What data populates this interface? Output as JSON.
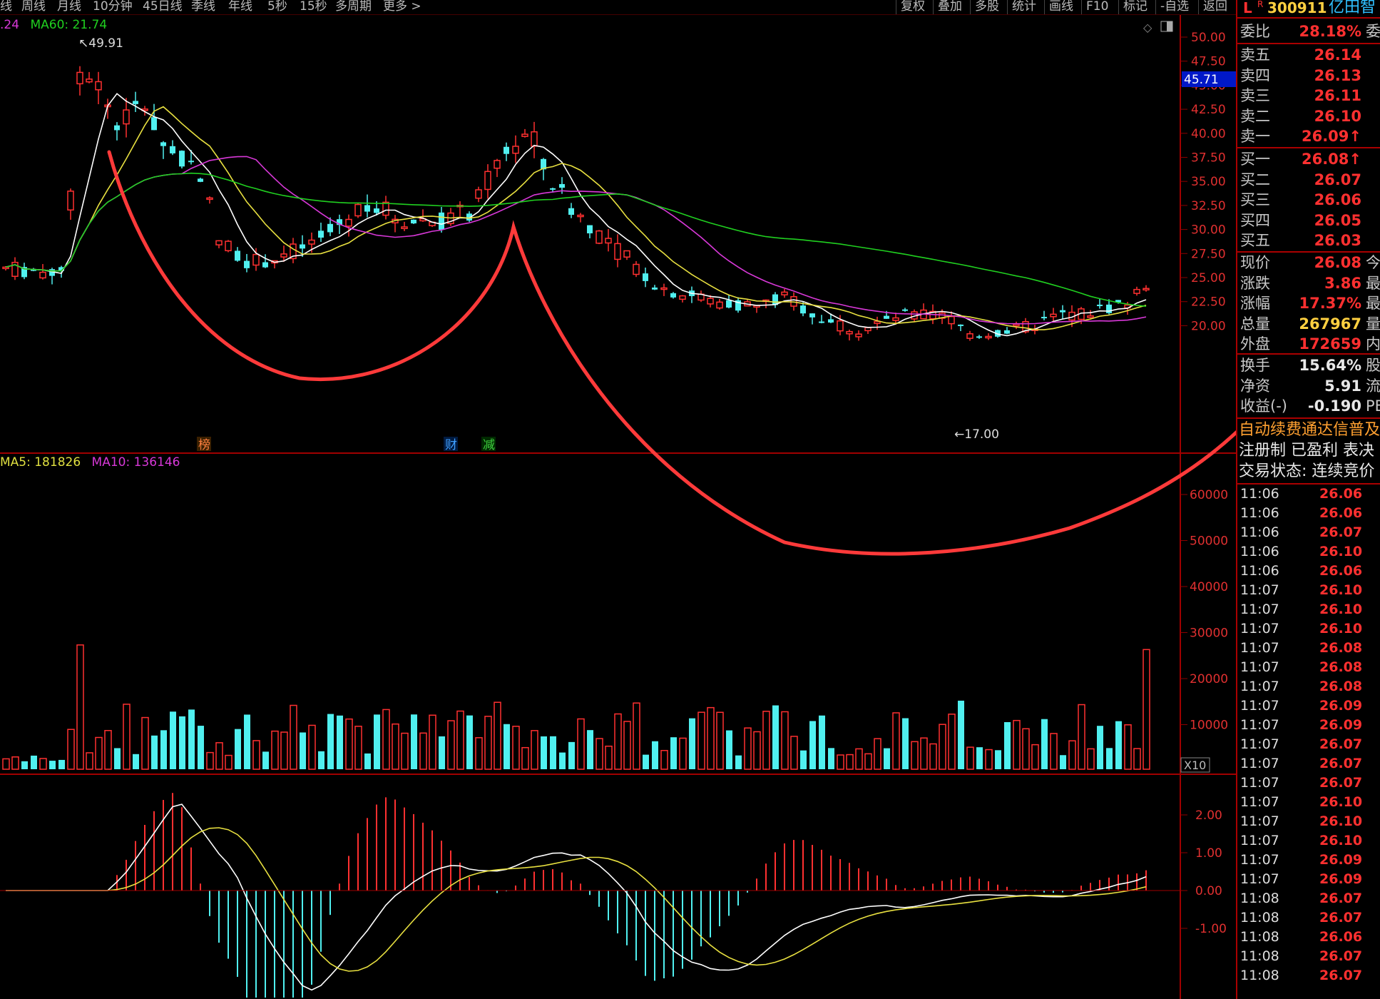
{
  "toolbar": {
    "left_items": [
      "线",
      "周线",
      "月线",
      "10分钟",
      "45日线",
      "季线",
      "年线",
      "5秒",
      "15秒",
      "多周期",
      "更多 >"
    ],
    "right_items": [
      "复权",
      "叠加",
      "多股",
      "统计",
      "画线",
      "F10",
      "标记",
      "-自选",
      "返回"
    ]
  },
  "main_chart": {
    "legend": [
      {
        "text": ".24",
        "color": "#d838d8"
      },
      {
        "text": "MA60: 21.74",
        "color": "#20d020"
      }
    ],
    "high_label": "49.91",
    "low_label": "17.00",
    "current_price_tag": "45.71",
    "y_ticks": [
      "50.00",
      "47.50",
      "45.00",
      "42.50",
      "40.00",
      "37.50",
      "35.00",
      "32.50",
      "30.00",
      "27.50",
      "25.00",
      "22.50",
      "20.00"
    ],
    "markers": [
      {
        "text": "榜",
        "color": "#ff8040"
      },
      {
        "text": "财",
        "color": "#40a0ff"
      },
      {
        "text": "减",
        "color": "#40d040"
      }
    ]
  },
  "volume_chart": {
    "legend": [
      {
        "text": "MA5: 181826",
        "color": "#e0e040"
      },
      {
        "text": "MA10: 136146",
        "color": "#d838d8"
      }
    ],
    "y_ticks": [
      "60000",
      "50000",
      "40000",
      "30000",
      "20000",
      "10000"
    ],
    "unit": "X10"
  },
  "macd_chart": {
    "y_ticks": [
      "2.00",
      "1.00",
      "0.00",
      "-1.00"
    ]
  },
  "quote": {
    "l": "L",
    "r": "R",
    "code": "300911",
    "name": "亿田智",
    "weibi_label": "委比",
    "weibi_value": "28.18%",
    "weibi_extra": "委",
    "asks": [
      {
        "label": "卖五",
        "price": "26.14"
      },
      {
        "label": "卖四",
        "price": "26.13"
      },
      {
        "label": "卖三",
        "price": "26.11"
      },
      {
        "label": "卖二",
        "price": "26.10"
      },
      {
        "label": "卖一",
        "price": "26.09↑"
      }
    ],
    "bids": [
      {
        "label": "买一",
        "price": "26.08↑"
      },
      {
        "label": "买二",
        "price": "26.07"
      },
      {
        "label": "买三",
        "price": "26.06"
      },
      {
        "label": "买四",
        "price": "26.05"
      },
      {
        "label": "买五",
        "price": "26.03"
      }
    ],
    "stats": [
      {
        "label": "现价",
        "value": "26.08",
        "extra": "今",
        "color": "#ff3030"
      },
      {
        "label": "涨跌",
        "value": "3.86",
        "extra": "最",
        "color": "#ff3030"
      },
      {
        "label": "涨幅",
        "value": "17.37%",
        "extra": "最",
        "color": "#ff3030"
      },
      {
        "label": "总量",
        "value": "267967",
        "extra": "量",
        "color": "#ffd040"
      },
      {
        "label": "外盘",
        "value": "172659",
        "extra": "内",
        "color": "#ff3030"
      }
    ],
    "stats2": [
      {
        "label": "换手",
        "value": "15.64%",
        "extra": "股",
        "color": "#e8e8e8"
      },
      {
        "label": "净资",
        "value": "5.91",
        "extra": "流",
        "color": "#e8e8e8"
      },
      {
        "label": "收益(-)",
        "value": "-0.190",
        "extra": "PE",
        "color": "#e8e8e8"
      }
    ],
    "notices": [
      {
        "text": "自动续费通达信普及",
        "color": "#ffa030"
      },
      {
        "text": "注册制 已盈利 表决",
        "color": "#e8e8e8"
      },
      {
        "text": "交易状态: 连续竞价",
        "color": "#e8e8e8"
      }
    ],
    "ticks": [
      {
        "time": "11:06",
        "price": "26.06"
      },
      {
        "time": "11:06",
        "price": "26.06"
      },
      {
        "time": "11:06",
        "price": "26.07"
      },
      {
        "time": "11:06",
        "price": "26.10"
      },
      {
        "time": "11:06",
        "price": "26.06"
      },
      {
        "time": "11:07",
        "price": "26.10"
      },
      {
        "time": "11:07",
        "price": "26.10"
      },
      {
        "time": "11:07",
        "price": "26.10"
      },
      {
        "time": "11:07",
        "price": "26.08"
      },
      {
        "time": "11:07",
        "price": "26.08"
      },
      {
        "time": "11:07",
        "price": "26.08"
      },
      {
        "time": "11:07",
        "price": "26.09"
      },
      {
        "time": "11:07",
        "price": "26.09"
      },
      {
        "time": "11:07",
        "price": "26.07"
      },
      {
        "time": "11:07",
        "price": "26.07"
      },
      {
        "time": "11:07",
        "price": "26.07"
      },
      {
        "time": "11:07",
        "price": "26.10"
      },
      {
        "time": "11:07",
        "price": "26.10"
      },
      {
        "time": "11:07",
        "price": "26.10"
      },
      {
        "time": "11:07",
        "price": "26.09"
      },
      {
        "time": "11:07",
        "price": "26.09"
      },
      {
        "time": "11:08",
        "price": "26.07"
      },
      {
        "time": "11:08",
        "price": "26.07"
      },
      {
        "time": "11:08",
        "price": "26.06"
      },
      {
        "time": "11:08",
        "price": "26.07"
      },
      {
        "time": "11:08",
        "price": "26.07"
      }
    ]
  },
  "colors": {
    "up": "#ff3030",
    "down": "#50f0f0",
    "ma5": "#ffffff",
    "ma10": "#e8e040",
    "ma20": "#d838d8",
    "ma60": "#20d020",
    "grid": "#8b0000",
    "annotation": "#ff3a3a"
  }
}
